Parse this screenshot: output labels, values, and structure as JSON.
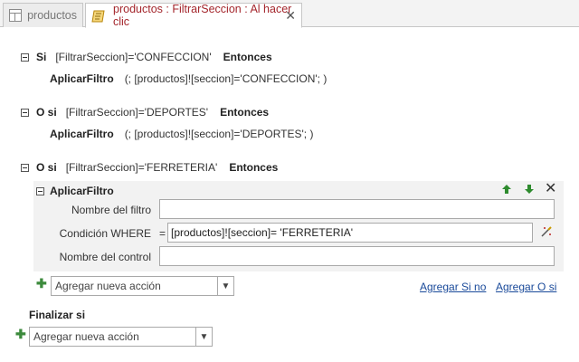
{
  "tabs": [
    {
      "label": "productos",
      "icon": "table-icon"
    },
    {
      "label": "productos : FiltrarSeccion : Al hacer clic",
      "icon": "macro-icon"
    }
  ],
  "blocks": [
    {
      "keyword": "Si",
      "condition": "[FiltrarSeccion]='CONFECCION'",
      "then": "Entonces",
      "action": "AplicarFiltro",
      "args": "(; [productos]![seccion]='CONFECCION'; )"
    },
    {
      "keyword": "O si",
      "condition": "[FiltrarSeccion]='DEPORTES'",
      "then": "Entonces",
      "action": "AplicarFiltro",
      "args": "(; [productos]![seccion]='DEPORTES'; )"
    },
    {
      "keyword": "O si",
      "condition": "[FiltrarSeccion]='FERRETERIA'",
      "then": "Entonces"
    }
  ],
  "expanded_action": {
    "name": "AplicarFiltro",
    "fields": {
      "filter_name_label": "Nombre del filtro",
      "filter_name_value": "",
      "where_label": "Condición WHERE",
      "where_eq": "=",
      "where_value": "[productos]![seccion]= 'FERRETERIA'",
      "control_name_label": "Nombre del control",
      "control_name_value": ""
    }
  },
  "inner_add_action": {
    "placeholder": "Agregar nueva acción"
  },
  "links": {
    "add_if": "Agregar Si no",
    "add_else_if": "Agregar O si"
  },
  "end_if": "Finalizar si",
  "outer_add_action": {
    "placeholder": "Agregar nueva acción"
  },
  "colors": {
    "active_tab_text": "#a4262c",
    "link": "#1a4a9a",
    "plus": "#3c8a3c",
    "arrow_green": "#2e8b2e"
  }
}
